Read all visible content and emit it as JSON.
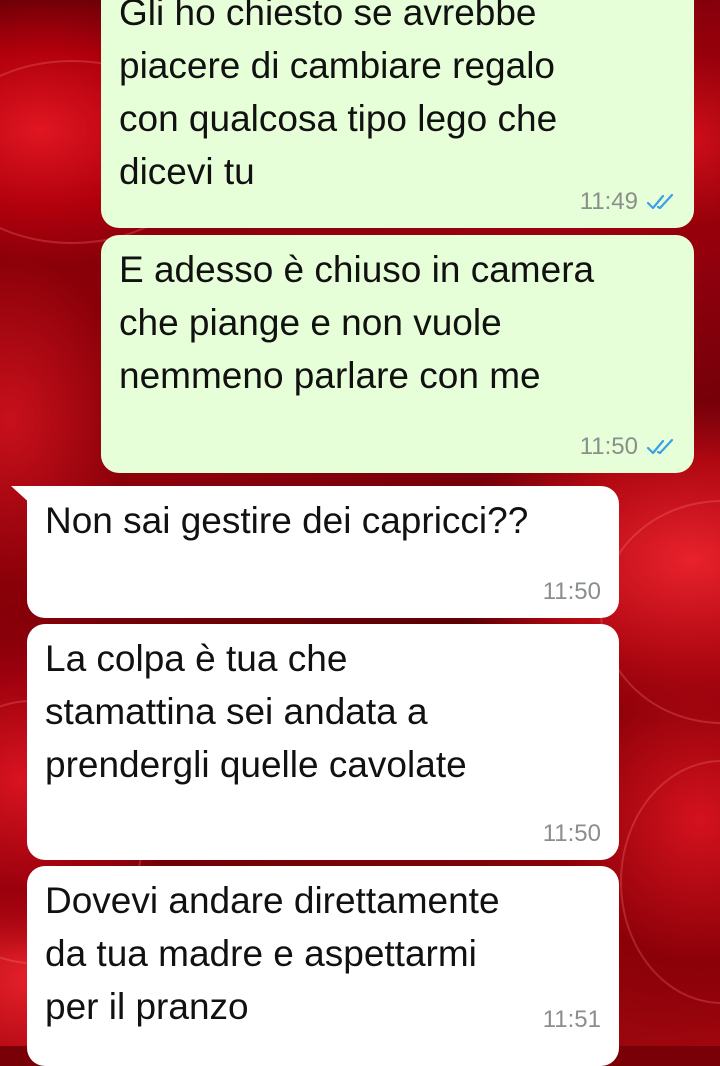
{
  "colors": {
    "outgoing_bubble": "#e6ffd8",
    "incoming_bubble": "#ffffff",
    "read_ticks": "#3aa0e6",
    "timestamp": "#8a8f8a"
  },
  "messages": [
    {
      "direction": "outgoing",
      "text": "Gli ho chiesto se avrebbe\npiacere di cambiare regalo\ncon qualcosa tipo lego che\ndicevi tu",
      "time": "11:49",
      "status_icon": "double-check-read-icon"
    },
    {
      "direction": "outgoing",
      "text": "E adesso è chiuso in camera\nche piange e non vuole\nnemmeno parlare con me",
      "time": "11:50",
      "status_icon": "double-check-read-icon"
    },
    {
      "direction": "incoming",
      "text": "Non sai gestire dei capricci??",
      "time": "11:50"
    },
    {
      "direction": "incoming",
      "text": "La colpa è tua che\nstamattina sei andata a\nprendergli quelle cavolate",
      "time": "11:50"
    },
    {
      "direction": "incoming",
      "text": "Dovevi andare direttamente\nda tua madre e aspettarmi\nper il pranzo",
      "time": "11:51"
    }
  ]
}
